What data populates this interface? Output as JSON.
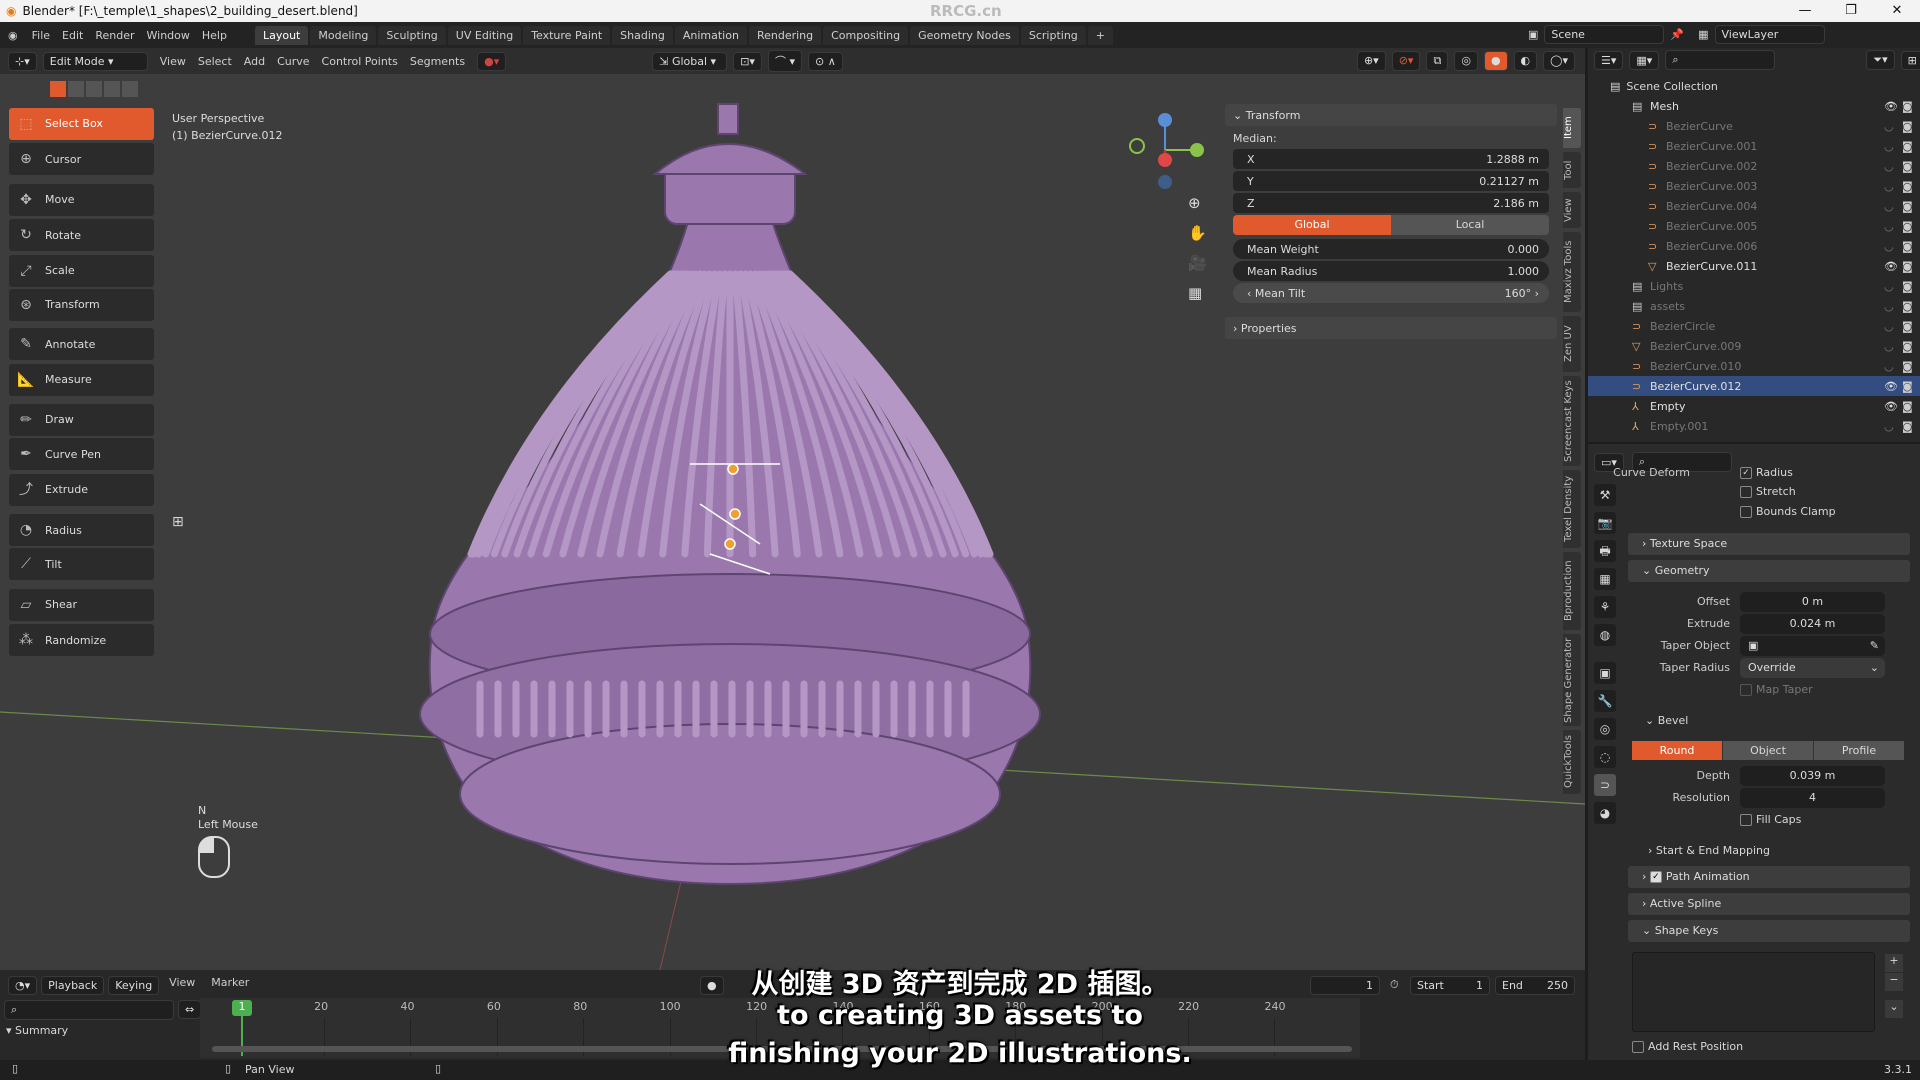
{
  "window": {
    "title": "Blender* [F:\\_temple\\1_shapes\\2_building_desert.blend]",
    "controls": [
      "—",
      "❐",
      "✕"
    ]
  },
  "menu": [
    "File",
    "Edit",
    "Render",
    "Window",
    "Help"
  ],
  "workspaces": [
    "Layout",
    "Modeling",
    "Sculpting",
    "UV Editing",
    "Texture Paint",
    "Shading",
    "Animation",
    "Rendering",
    "Compositing",
    "Geometry Nodes",
    "Scripting",
    "+"
  ],
  "active_workspace": "Layout",
  "scene": {
    "label": "Scene",
    "view_layer": "ViewLayer"
  },
  "header": {
    "mode": "Edit Mode",
    "menus": [
      "View",
      "Select",
      "Add",
      "Curve",
      "Control Points",
      "Segments"
    ],
    "orientation": "Global"
  },
  "viewport": {
    "perspective": "User Perspective",
    "object": "(1) BezierCurve.012",
    "key_hint": "N",
    "mouse_hint": "Left Mouse"
  },
  "tools": [
    {
      "label": "Select Box",
      "icon": "select-box-icon",
      "active": true
    },
    {
      "label": "Cursor",
      "icon": "cursor-icon"
    },
    {
      "label": "Move",
      "icon": "move-icon"
    },
    {
      "label": "Rotate",
      "icon": "rotate-icon"
    },
    {
      "label": "Scale",
      "icon": "scale-icon"
    },
    {
      "label": "Transform",
      "icon": "transform-icon"
    },
    {
      "label": "Annotate",
      "icon": "annotate-icon"
    },
    {
      "label": "Measure",
      "icon": "measure-icon"
    },
    {
      "label": "Draw",
      "icon": "draw-icon"
    },
    {
      "label": "Curve Pen",
      "icon": "curve-pen-icon"
    },
    {
      "label": "Extrude",
      "icon": "extrude-icon"
    },
    {
      "label": "Radius",
      "icon": "radius-icon"
    },
    {
      "label": "Tilt",
      "icon": "tilt-icon"
    },
    {
      "label": "Shear",
      "icon": "shear-icon"
    },
    {
      "label": "Randomize",
      "icon": "randomize-icon"
    }
  ],
  "transform": {
    "title": "Transform",
    "median": "Median:",
    "x_label": "X",
    "x": "1.2888 m",
    "y_label": "Y",
    "y": "0.21127 m",
    "z_label": "Z",
    "z": "2.186 m",
    "global": "Global",
    "local": "Local",
    "mean_weight_label": "Mean Weight",
    "mean_weight": "0.000",
    "mean_radius_label": "Mean Radius",
    "mean_radius": "1.000",
    "mean_tilt_label": "Mean Tilt",
    "mean_tilt": "160°",
    "properties": "Properties"
  },
  "side_tabs": [
    "Item",
    "Tool",
    "View",
    "Maxivz Tools",
    "Zen UV",
    "Screencast Keys",
    "Texel Density",
    "Bproduction",
    "Shape Generator",
    "QuickTools"
  ],
  "outliner": {
    "root": "Scene Collection",
    "rows": [
      {
        "name": "Mesh",
        "type": "collection",
        "visible": true
      },
      {
        "name": "BezierCurve",
        "type": "curve",
        "visible": false
      },
      {
        "name": "BezierCurve.001",
        "type": "curve",
        "visible": false
      },
      {
        "name": "BezierCurve.002",
        "type": "curve",
        "visible": false
      },
      {
        "name": "BezierCurve.003",
        "type": "curve",
        "visible": false
      },
      {
        "name": "BezierCurve.004",
        "type": "curve",
        "visible": false
      },
      {
        "name": "BezierCurve.005",
        "type": "curve",
        "visible": false
      },
      {
        "name": "BezierCurve.006",
        "type": "curve",
        "visible": false
      },
      {
        "name": "BezierCurve.011",
        "type": "mesh",
        "visible": true
      },
      {
        "name": "Lights",
        "type": "collection",
        "visible": false
      },
      {
        "name": "assets",
        "type": "collection",
        "visible": false
      },
      {
        "name": "BezierCircle",
        "type": "curve",
        "visible": false
      },
      {
        "name": "BezierCurve.009",
        "type": "mesh",
        "visible": false
      },
      {
        "name": "BezierCurve.010",
        "type": "curve",
        "visible": false
      },
      {
        "name": "BezierCurve.012",
        "type": "curve",
        "visible": true,
        "active": true
      },
      {
        "name": "Empty",
        "type": "empty",
        "visible": true
      },
      {
        "name": "Empty.001",
        "type": "empty",
        "visible": false
      }
    ]
  },
  "properties": {
    "curve_deform": "Curve Deform",
    "radius": "Radius",
    "stretch": "Stretch",
    "bounds_clamp": "Bounds Clamp",
    "texture_space": "Texture Space",
    "geometry": "Geometry",
    "offset_label": "Offset",
    "offset": "0 m",
    "extrude_label": "Extrude",
    "extrude": "0.024 m",
    "taper_object_label": "Taper Object",
    "taper_radius_label": "Taper Radius",
    "taper_radius": "Override",
    "map_taper": "Map Taper",
    "bevel": "Bevel",
    "bevel_modes": [
      "Round",
      "Object",
      "Profile"
    ],
    "depth_label": "Depth",
    "depth": "0.039 m",
    "resolution_label": "Resolution",
    "resolution": "4",
    "fill_caps": "Fill Caps",
    "start_end": "Start & End Mapping",
    "path_animation": "Path Animation",
    "active_spline": "Active Spline",
    "shape_keys": "Shape Keys",
    "add_rest": "Add Rest Position"
  },
  "timeline": {
    "menus": [
      "Playback",
      "Keying",
      "View",
      "Marker"
    ],
    "current_frame": "1",
    "start_label": "Start",
    "start": "1",
    "end_label": "End",
    "end": "250",
    "ticks": [
      "20",
      "40",
      "60",
      "80",
      "100",
      "120",
      "140",
      "160",
      "180",
      "200",
      "220",
      "240"
    ],
    "summary": "Summary"
  },
  "status": {
    "pan_view": "Pan View",
    "version": "3.3.1"
  },
  "subtitles": {
    "zh": "从创建 3D 资产到完成 2D 插图。",
    "en1": "to creating 3D assets to",
    "en2": "finishing your 2D illustrations."
  },
  "watermark": "RRCG.cn",
  "colors": {
    "accent": "#e05a2d",
    "object": "#9a78ae",
    "frame": "#4caf50"
  }
}
